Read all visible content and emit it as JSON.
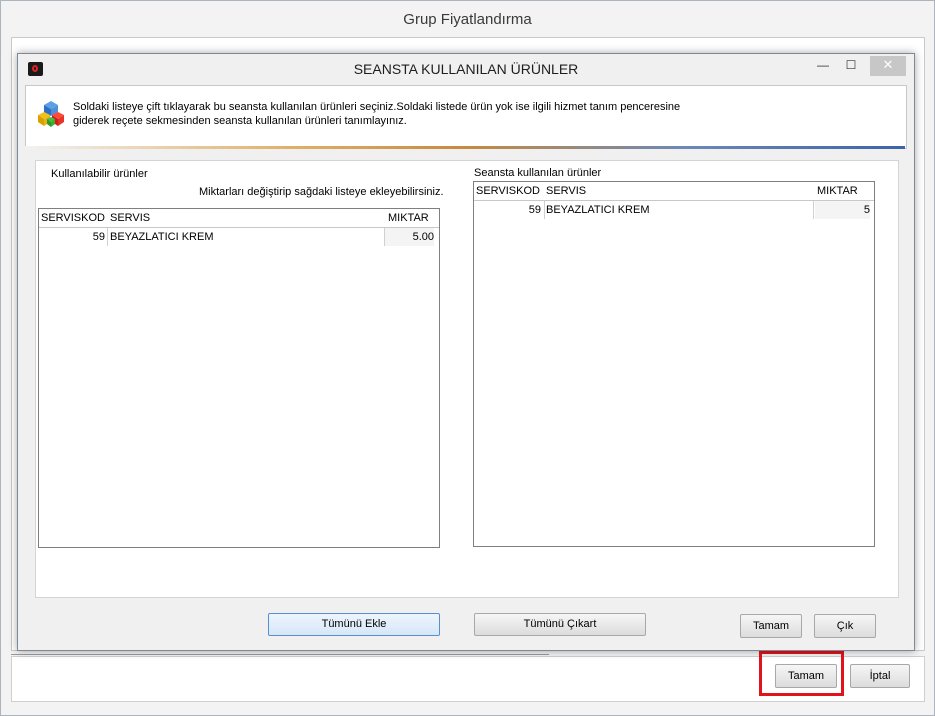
{
  "outer_window": {
    "title": "Grup Fiyatlandırma",
    "buttons": {
      "ok": "Tamam",
      "cancel": "İptal"
    }
  },
  "dialog": {
    "title": "SEANSTA KULLANILAN ÜRÜNLER",
    "controls": {
      "minimize": "—",
      "maximize": "☐",
      "close": "✕"
    },
    "info_text_line1": "Soldaki listeye çift tıklayarak bu seansta kullanılan ürünleri seçiniz.Soldaki listede ürün yok ise ilgili hizmet tanım penceresine",
    "info_text_line2": "giderek reçete sekmesinden seansta kullanılan ürünleri tanımlayınız.",
    "left": {
      "title": "Kullanılabilir ürünler",
      "hint": "Miktarları değiştirip sağdaki listeye ekleyebilirsiniz.",
      "columns": [
        "SERVISKOD",
        "SERVIS",
        "MIKTAR"
      ],
      "rows": [
        {
          "kod": "59",
          "servis": "BEYAZLATICI KREM",
          "miktar": "5.00"
        }
      ],
      "button": "Tümünü Ekle"
    },
    "right": {
      "title": "Seansta kullanılan ürünler",
      "columns": [
        "SERVISKOD",
        "SERVIS",
        "MIKTAR"
      ],
      "rows": [
        {
          "kod": "59",
          "servis": "BEYAZLATICI KREM",
          "miktar": "5"
        }
      ],
      "button": "Tümünü Çıkart"
    },
    "footer_buttons": {
      "ok": "Tamam",
      "exit": "Çık"
    }
  },
  "colors": {
    "highlight": "#e0141c",
    "accent_blue": "#3f63a7"
  },
  "icons": [
    "app-icon",
    "cubes-info-icon"
  ]
}
